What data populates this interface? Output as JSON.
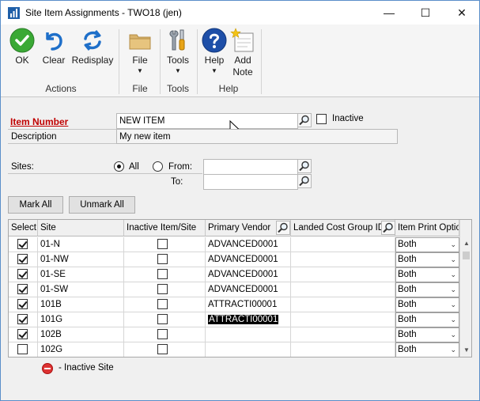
{
  "window": {
    "title": "Site Item Assignments  -  TWO18 (jen)",
    "minimize_glyph": "—",
    "maximize_glyph": "☐",
    "close_glyph": "✕"
  },
  "ribbon": {
    "ok_label": "OK",
    "clear_label": "Clear",
    "redisplay_label": "Redisplay",
    "file_label": "File",
    "tools_label": "Tools",
    "help_label": "Help",
    "add_note_label_1": "Add",
    "add_note_label_2": "Note",
    "arrow_glyph": "▼",
    "groups": {
      "actions": "Actions",
      "file": "File",
      "tools": "Tools",
      "help": "Help"
    }
  },
  "form": {
    "item_number_label": "Item Number",
    "item_number_value": "NEW ITEM",
    "inactive_label": "Inactive",
    "description_label": "Description",
    "description_value": "My new item",
    "sites_label": "Sites:",
    "all_label": "All",
    "from_label": "From:",
    "to_label": "To:",
    "from_value": "",
    "to_value": "",
    "mark_all_label": "Mark All",
    "unmark_all_label": "Unmark All"
  },
  "grid": {
    "columns": [
      "Select",
      "Site",
      "Inactive Item/Site",
      "Primary Vendor",
      "Landed Cost Group ID",
      "Item Print Option"
    ],
    "rows": [
      {
        "selected": true,
        "site": "01-N",
        "inactive": false,
        "vendor": "ADVANCED0001",
        "lcg": "",
        "print": "Both"
      },
      {
        "selected": true,
        "site": "01-NW",
        "inactive": false,
        "vendor": "ADVANCED0001",
        "lcg": "",
        "print": "Both"
      },
      {
        "selected": true,
        "site": "01-SE",
        "inactive": false,
        "vendor": "ADVANCED0001",
        "lcg": "",
        "print": "Both"
      },
      {
        "selected": true,
        "site": "01-SW",
        "inactive": false,
        "vendor": "ADVANCED0001",
        "lcg": "",
        "print": "Both"
      },
      {
        "selected": true,
        "site": "101B",
        "inactive": false,
        "vendor": "ATTRACTI00001",
        "lcg": "",
        "print": "Both"
      },
      {
        "selected": true,
        "site": "101G",
        "inactive": false,
        "vendor": "ATTRACTI00001",
        "lcg": "",
        "print": "Both"
      },
      {
        "selected": true,
        "site": "102B",
        "inactive": false,
        "vendor": "",
        "lcg": "",
        "print": "Both"
      },
      {
        "selected": false,
        "site": "102G",
        "inactive": false,
        "vendor": "",
        "lcg": "",
        "print": "Both"
      }
    ]
  },
  "legend": {
    "inactive_site_label": "- Inactive Site"
  },
  "colors": {
    "ok_green": "#3aa935",
    "icon_blue": "#1e6fc9",
    "item_number_red": "#c00000",
    "folder_tan": "#d9b36c"
  }
}
